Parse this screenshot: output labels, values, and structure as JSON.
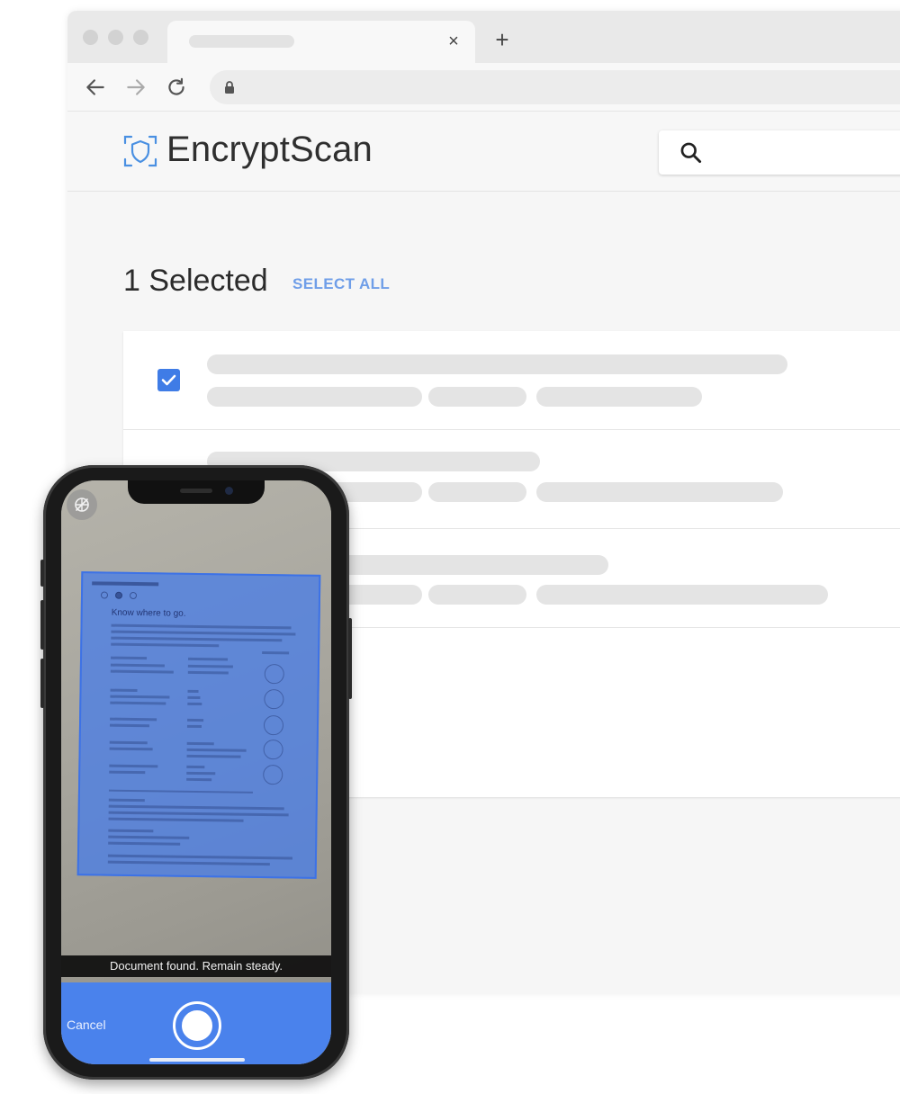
{
  "browser": {
    "tab_close_glyph": "×",
    "new_tab_glyph": "+",
    "icons": [
      "back-arrow-icon",
      "forward-arrow-icon",
      "reload-icon",
      "lock-icon"
    ]
  },
  "app": {
    "brand": "EncryptScan",
    "search_icon": "search-icon"
  },
  "selection": {
    "count_label": "1 Selected",
    "select_all_label": "SELECT ALL"
  },
  "rows": [
    {
      "checked": true
    },
    {
      "checked": false
    },
    {
      "checked": false
    }
  ],
  "phone": {
    "document_headline": "Know where to go.",
    "status": "Document found. Remain steady.",
    "cancel_label": "Cancel"
  },
  "colors": {
    "accent": "#3f7ce6",
    "select_all": "#6f9ee8",
    "scanner_bar": "#4a82ec",
    "document_overlay": "#4a7de6"
  }
}
